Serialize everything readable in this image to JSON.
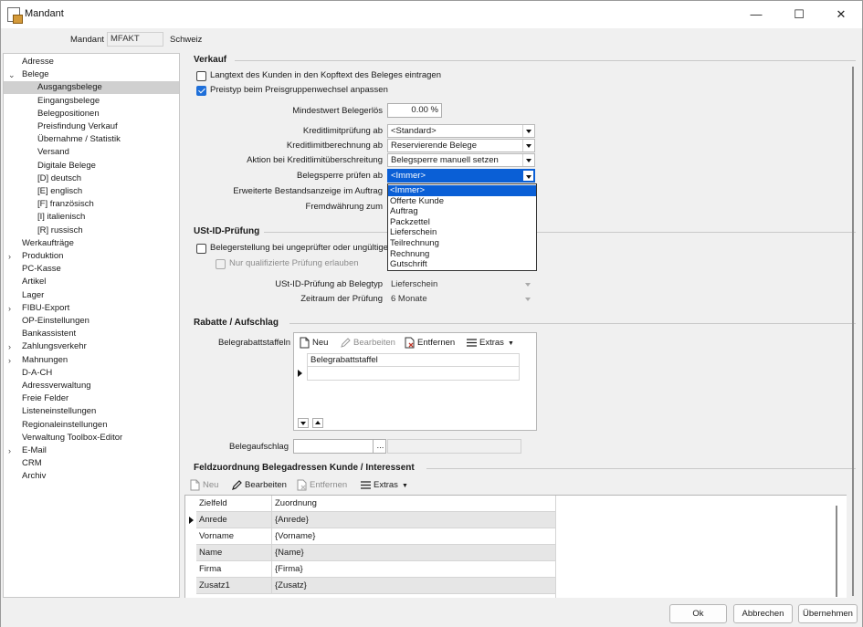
{
  "window": {
    "title": "Mandant",
    "minimize": "—",
    "maximize": "☐",
    "close": "✕"
  },
  "mandant": {
    "label": "Mandant",
    "value": "MFAKT",
    "name": "Schweiz"
  },
  "tree": [
    {
      "label": "Adresse",
      "level": 0,
      "chevron": ""
    },
    {
      "label": "Belege",
      "level": 0,
      "chevron": "⌄"
    },
    {
      "label": "Ausgangsbelege",
      "level": 1,
      "chevron": "",
      "selected": true
    },
    {
      "label": "Eingangsbelege",
      "level": 1,
      "chevron": ""
    },
    {
      "label": "Belegpositionen",
      "level": 1,
      "chevron": ""
    },
    {
      "label": "Preisfindung Verkauf",
      "level": 1,
      "chevron": ""
    },
    {
      "label": "Übernahme / Statistik",
      "level": 1,
      "chevron": ""
    },
    {
      "label": "Versand",
      "level": 1,
      "chevron": ""
    },
    {
      "label": "Digitale Belege",
      "level": 1,
      "chevron": ""
    },
    {
      "label": "[D] deutsch",
      "level": 1,
      "chevron": ""
    },
    {
      "label": "[E] englisch",
      "level": 1,
      "chevron": ""
    },
    {
      "label": "[F] französisch",
      "level": 1,
      "chevron": ""
    },
    {
      "label": "[I] italienisch",
      "level": 1,
      "chevron": ""
    },
    {
      "label": "[R] russisch",
      "level": 1,
      "chevron": ""
    },
    {
      "label": "Werkaufträge",
      "level": 0,
      "chevron": ""
    },
    {
      "label": "Produktion",
      "level": 0,
      "chevron": "›"
    },
    {
      "label": "PC-Kasse",
      "level": 0,
      "chevron": ""
    },
    {
      "label": "Artikel",
      "level": 0,
      "chevron": ""
    },
    {
      "label": "Lager",
      "level": 0,
      "chevron": ""
    },
    {
      "label": "FIBU-Export",
      "level": 0,
      "chevron": "›"
    },
    {
      "label": "OP-Einstellungen",
      "level": 0,
      "chevron": ""
    },
    {
      "label": "Bankassistent",
      "level": 0,
      "chevron": ""
    },
    {
      "label": "Zahlungsverkehr",
      "level": 0,
      "chevron": "›"
    },
    {
      "label": "Mahnungen",
      "level": 0,
      "chevron": "›"
    },
    {
      "label": "D-A-CH",
      "level": 0,
      "chevron": ""
    },
    {
      "label": "Adressverwaltung",
      "level": 0,
      "chevron": ""
    },
    {
      "label": "Freie Felder",
      "level": 0,
      "chevron": ""
    },
    {
      "label": "Listeneinstellungen",
      "level": 0,
      "chevron": ""
    },
    {
      "label": "Regionaleinstellungen",
      "level": 0,
      "chevron": ""
    },
    {
      "label": "Verwaltung Toolbox-Editor",
      "level": 0,
      "chevron": ""
    },
    {
      "label": "E-Mail",
      "level": 0,
      "chevron": "›"
    },
    {
      "label": "CRM",
      "level": 0,
      "chevron": ""
    },
    {
      "label": "Archiv",
      "level": 0,
      "chevron": ""
    }
  ],
  "verkauf": {
    "title": "Verkauf",
    "cb_langtext": "Langtext des Kunden in den Kopftext des Beleges eintragen",
    "cb_langtext_checked": false,
    "cb_preistyp": "Preistyp beim Preisgruppenwechsel anpassen",
    "cb_preistyp_checked": true,
    "mindestwert_label": "Mindestwert Belegerlös",
    "mindestwert_value": "0.00 %",
    "kreditlimitpruefung_label": "Kreditlimitprüfung ab",
    "kreditlimitpruefung_value": "<Standard>",
    "kreditlimitberechnung_label": "Kreditlimitberechnung ab",
    "kreditlimitberechnung_value": "Reservierende Belege",
    "aktion_label": "Aktion bei Kreditlimitüberschreitung",
    "aktion_value": "Belegsperre manuell setzen",
    "belegsperre_label": "Belegsperre prüfen ab",
    "belegsperre_value": "<Immer>",
    "bestandsanzeige_label": "Erweiterte Bestandsanzeige im Auftrag",
    "fremdwaehrung_label": "Fremdwährung zum",
    "dropdown_options": [
      "<Immer>",
      "Offerte Kunde",
      "Auftrag",
      "Packzettel",
      "Lieferschein",
      "Teilrechnung",
      "Rechnung",
      "Gutschrift"
    ],
    "dropdown_selected": "<Immer>"
  },
  "ustid": {
    "title": "USt-ID-Prüfung",
    "cb_belegerstellung": "Belegerstellung bei ungeprüfter oder ungültiger",
    "cb_qualifiziert": "Nur qualifizierte Prüfung erlauben",
    "belegtyp_label": "USt-ID-Prüfung ab Belegtyp",
    "belegtyp_value": "Lieferschein",
    "zeitraum_label": "Zeitraum der Prüfung",
    "zeitraum_value": "6 Monate"
  },
  "rabatte": {
    "title": "Rabatte / Aufschlag",
    "staffeln_label": "Belegrabattstaffeln",
    "toolbar": {
      "neu": "Neu",
      "bearbeiten": "Bearbeiten",
      "entfernen": "Entfernen",
      "extras": "Extras"
    },
    "grid_header": "Belegrabattstaffel",
    "aufschlag_label": "Belegaufschlag",
    "ellipsis": "..."
  },
  "feldzuordnung": {
    "title": "Feldzuordnung Belegadressen Kunde / Interessent",
    "toolbar": {
      "neu": "Neu",
      "bearbeiten": "Bearbeiten",
      "entfernen": "Entfernen",
      "extras": "Extras"
    },
    "columns": [
      "Zielfeld",
      "Zuordnung"
    ],
    "rows": [
      [
        "Anrede",
        "{Anrede}"
      ],
      [
        "Vorname",
        "{Vorname}"
      ],
      [
        "Name",
        "{Name}"
      ],
      [
        "Firma",
        "{Firma}"
      ],
      [
        "Zusatz1",
        "{Zusatz}"
      ]
    ]
  },
  "footer": {
    "ok": "Ok",
    "abbrechen": "Abbrechen",
    "uebernehmen": "Übernehmen"
  },
  "colors": {
    "selection": "#0a5fd6",
    "tree_selected": "#d0d0d0",
    "checkbox": "#1e6fd9"
  }
}
